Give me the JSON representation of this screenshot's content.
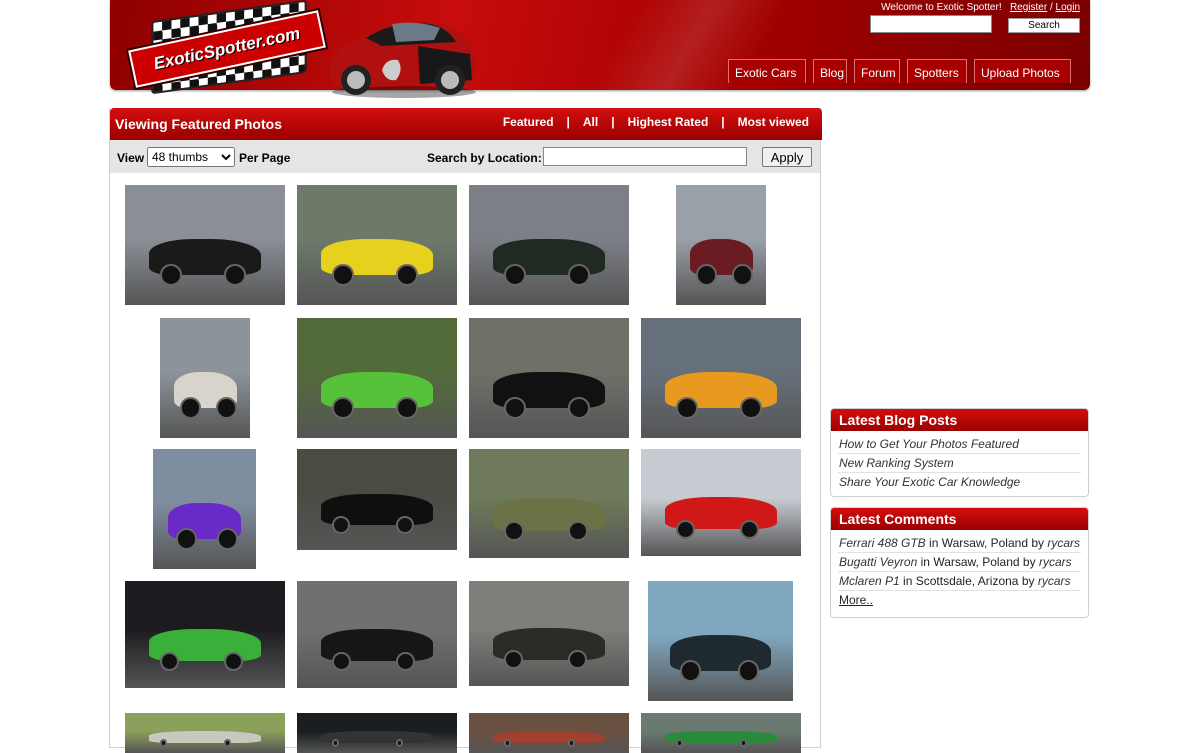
{
  "header": {
    "logo_text": "ExoticSpotter.com",
    "welcome": "Welcome to Exotic Spotter!",
    "register": "Register",
    "separator": "/",
    "login": "Login",
    "search_button": "Search",
    "search_value": "",
    "nav": [
      "Exotic Cars",
      "Blog",
      "Forum",
      "Spotters",
      "Upload Photos"
    ]
  },
  "panel": {
    "title": "Viewing Featured Photos",
    "links": [
      "Featured",
      "All",
      "Highest Rated",
      "Most viewed"
    ],
    "link_separator": "|",
    "view_label": "View",
    "view_selected": "48 thumbs",
    "per_page_label": "Per Page",
    "location_label": "Search by Location:",
    "location_value": "",
    "apply_button": "Apply"
  },
  "thumbnails": [
    {
      "name": "street-grey-supercar",
      "bg": "#8a8f96",
      "car": "#1a1a1a"
    },
    {
      "name": "parking-yellow-ferrari",
      "bg": "#6d7a6a",
      "car": "#e6d21e"
    },
    {
      "name": "black-ferrari-purosangue",
      "bg": "#7c7f86",
      "car": "#1f2a22"
    },
    {
      "name": "red-aston-martin",
      "bg": "#9aa0a8",
      "car": "#6a1c22"
    },
    {
      "name": "white-lamborghini-urus",
      "bg": "#8c949a",
      "car": "#d8d4cc"
    },
    {
      "name": "green-lamborghini-group",
      "bg": "#536b3a",
      "car": "#55c23a"
    },
    {
      "name": "black-nissan-gtr",
      "bg": "#6e7168",
      "car": "#111111"
    },
    {
      "name": "orange-porsche-rwb",
      "bg": "#66707a",
      "car": "#e89a20"
    },
    {
      "name": "purple-lamborghini",
      "bg": "#7f8da0",
      "car": "#6a2ac8"
    },
    {
      "name": "black-huracan-spyder",
      "bg": "#4a4c44",
      "car": "#0f0f10"
    },
    {
      "name": "green-huracan-sterrato",
      "bg": "#6e7a5a",
      "car": "#6b7346"
    },
    {
      "name": "red-ferrari-488-pista",
      "bg": "#c8ccd2",
      "car": "#d01818"
    },
    {
      "name": "green-audi-r8-night",
      "bg": "#1c1c20",
      "car": "#3ab03a"
    },
    {
      "name": "black-aston-db11",
      "bg": "#70706e",
      "car": "#161616"
    },
    {
      "name": "black-mclaren-750s",
      "bg": "#7e7e7a",
      "car": "#2a2a26"
    },
    {
      "name": "black-lamborghini-palms",
      "bg": "#7fa8c0",
      "car": "#1e2a30"
    },
    {
      "name": "partial-tree-street",
      "bg": "#8ba05a",
      "car": "#c8c8c0"
    },
    {
      "name": "partial-dark-garage",
      "bg": "#1a1e20",
      "car": "#333333"
    },
    {
      "name": "partial-parking-garage",
      "bg": "#6a5040",
      "car": "#a04030"
    },
    {
      "name": "partial-green-car",
      "bg": "#6a7a70",
      "car": "#2a8a3a"
    }
  ],
  "blog": {
    "title": "Latest Blog Posts",
    "items": [
      "How to Get Your Photos Featured",
      "New Ranking System",
      "Share Your Exotic Car Knowledge"
    ]
  },
  "comments": {
    "title": "Latest Comments",
    "items": [
      {
        "car": "Ferrari 488 GTB",
        "in": "in",
        "place": "Warsaw, Poland",
        "by": "by",
        "user": "rycars"
      },
      {
        "car": "Bugatti Veyron",
        "in": "in",
        "place": "Warsaw, Poland",
        "by": "by",
        "user": "rycars"
      },
      {
        "car": "Mclaren P1",
        "in": "in",
        "place": "Scottsdale, Arizona",
        "by": "by",
        "user": "rycars"
      }
    ],
    "more": "More.."
  }
}
